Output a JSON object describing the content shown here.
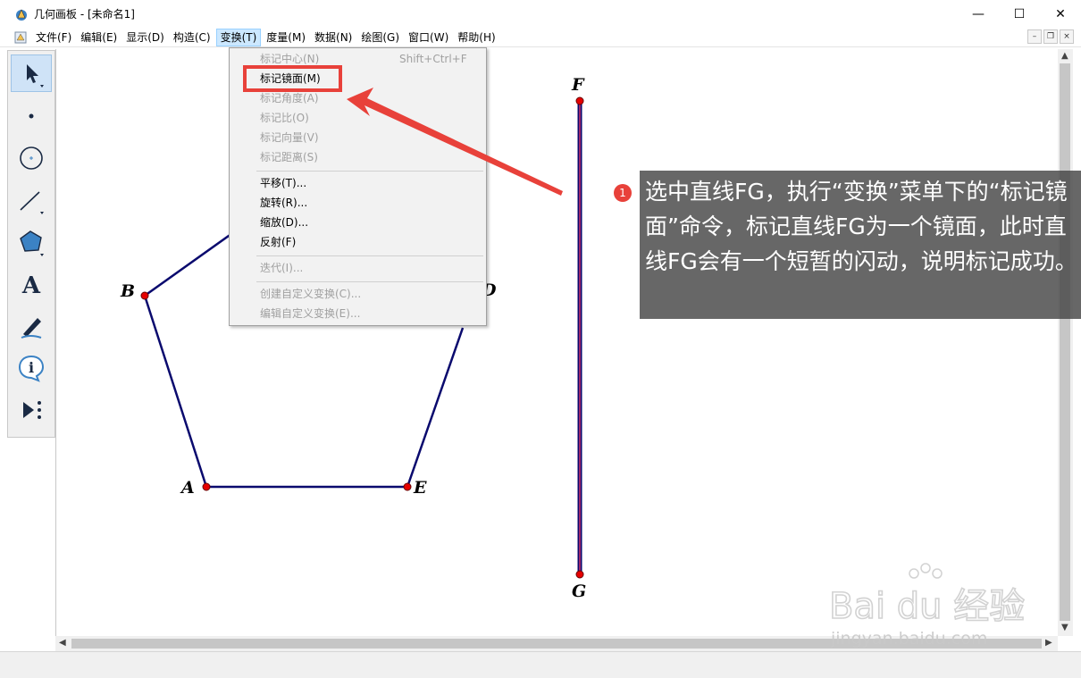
{
  "window": {
    "title": "几何画板 - [未命名1]",
    "minimize": "—",
    "maximize": "☐",
    "close": "✕"
  },
  "menubar": {
    "items": [
      "文件(F)",
      "编辑(E)",
      "显示(D)",
      "构造(C)",
      "变换(T)",
      "度量(M)",
      "数据(N)",
      "绘图(G)",
      "窗口(W)",
      "帮助(H)"
    ],
    "active_index": 4,
    "mdi_minimize": "–",
    "mdi_restore": "❐",
    "mdi_close": "×"
  },
  "transform_menu": {
    "items": [
      {
        "label": "标记中心(N)",
        "shortcut": "Shift+Ctrl+F",
        "disabled": true
      },
      {
        "label": "标记镜面(M)",
        "shortcut": "",
        "disabled": false
      },
      {
        "label": "标记角度(A)",
        "shortcut": "",
        "disabled": true
      },
      {
        "label": "标记比(O)",
        "shortcut": "",
        "disabled": true
      },
      {
        "label": "标记向量(V)",
        "shortcut": "",
        "disabled": true
      },
      {
        "label": "标记距离(S)",
        "shortcut": "",
        "disabled": true
      },
      {
        "label": "平移(T)...",
        "shortcut": "",
        "disabled": false
      },
      {
        "label": "旋转(R)...",
        "shortcut": "",
        "disabled": false
      },
      {
        "label": "缩放(D)...",
        "shortcut": "",
        "disabled": false
      },
      {
        "label": "反射(F)",
        "shortcut": "",
        "disabled": false
      },
      {
        "label": "迭代(I)...",
        "shortcut": "",
        "disabled": true
      },
      {
        "label": "创建自定义变换(C)...",
        "shortcut": "",
        "disabled": true
      },
      {
        "label": "编辑自定义变换(E)...",
        "shortcut": "",
        "disabled": true
      }
    ],
    "highlighted_index": 1
  },
  "toolbox": {
    "tools": [
      "selection-arrow-icon",
      "point-icon",
      "compass-icon",
      "straightedge-icon",
      "polygon-icon",
      "text-icon",
      "marker-icon",
      "information-icon",
      "custom-tool-icon"
    ],
    "selected_index": 0
  },
  "sketch": {
    "points": [
      "A",
      "B",
      "E",
      "F",
      "G",
      "D"
    ],
    "line_color": "#0a0a6e",
    "point_color": "#e60000"
  },
  "annotation": {
    "badge": "1",
    "text": "选中直线FG，执行“变换”菜单下的“标记镜面”命令，标记直线FG为一个镜面，此时直线FG会有一个短暂的闪动，说明标记成功。",
    "color": "#e8413a"
  },
  "scrollbars": {
    "up": "▲",
    "down": "▼",
    "left": "◀",
    "right": "▶"
  },
  "watermark": {
    "brand": "Bai du 经验",
    "url": "jingyan.baidu.com"
  }
}
